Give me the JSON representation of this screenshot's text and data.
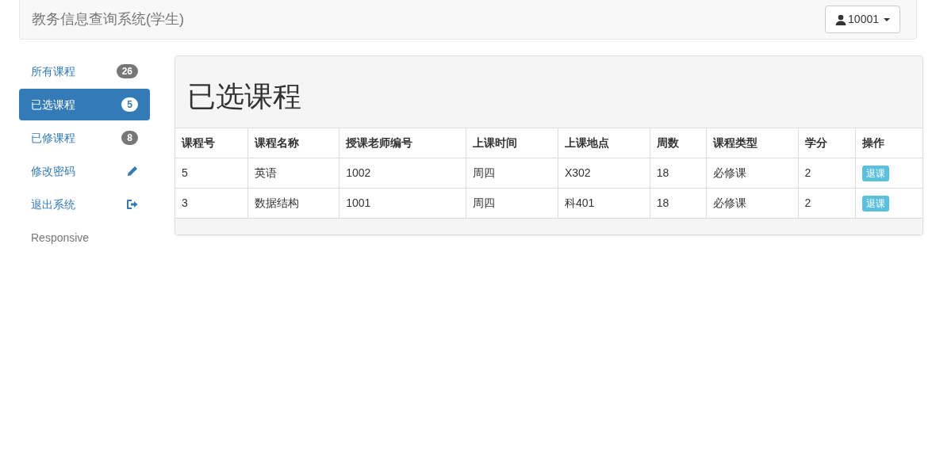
{
  "navbar": {
    "brand": "教务信息查询系统(学生)",
    "user_button": "10001"
  },
  "sidebar": {
    "items": [
      {
        "label": "所有课程",
        "kind": "badge",
        "badge": "26",
        "selected": false
      },
      {
        "label": "已选课程",
        "kind": "badge",
        "badge": "5",
        "selected": true
      },
      {
        "label": "已修课程",
        "kind": "badge",
        "badge": "8",
        "selected": false
      },
      {
        "label": "修改密码",
        "kind": "pencil",
        "selected": false
      },
      {
        "label": "退出系统",
        "kind": "logout",
        "selected": false
      },
      {
        "label": "Responsive",
        "kind": "header"
      }
    ]
  },
  "panel": {
    "title": "已选课程",
    "table": {
      "columns": [
        "课程号",
        "课程名称",
        "授课老师编号",
        "上课时间",
        "上课地点",
        "周数",
        "课程类型",
        "学分",
        "操作"
      ],
      "rows": [
        {
          "cells": [
            "5",
            "英语",
            "1002",
            "周四",
            "X302",
            "18",
            "必修课",
            "2"
          ],
          "action": "退课"
        },
        {
          "cells": [
            "3",
            "数据结构",
            "1001",
            "周四",
            "科401",
            "18",
            "必修课",
            "2"
          ],
          "action": "退课"
        }
      ]
    }
  }
}
